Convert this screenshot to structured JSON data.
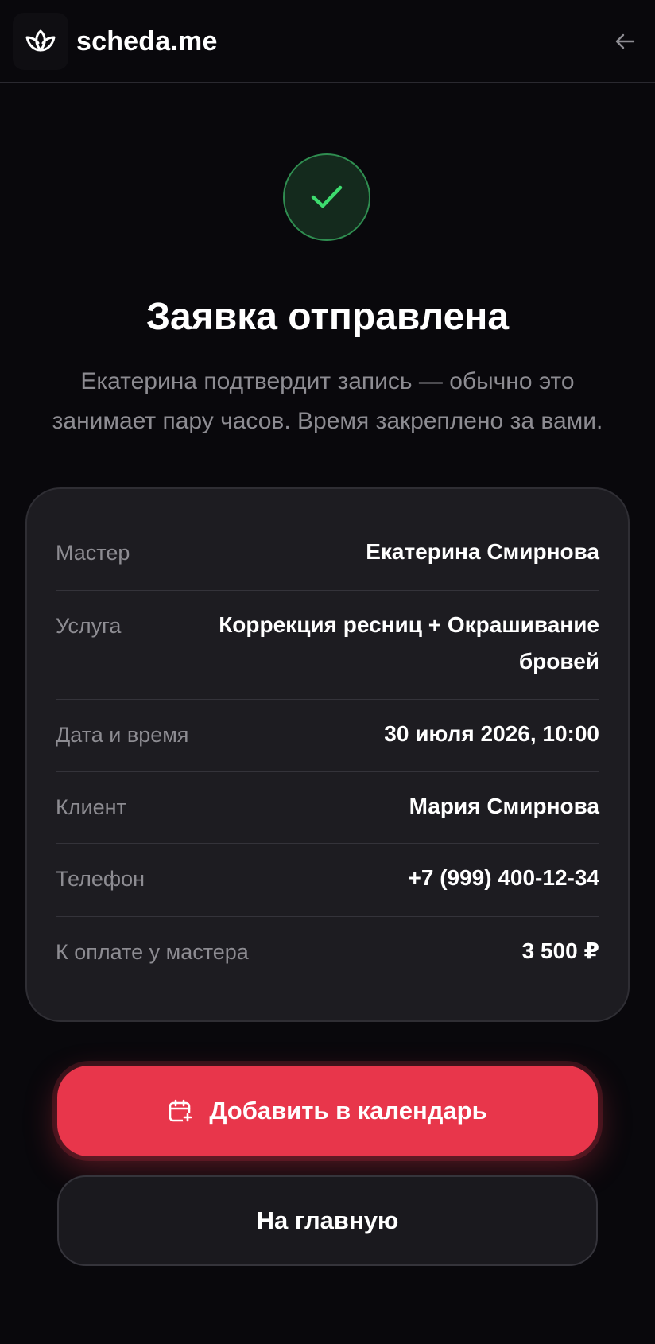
{
  "header": {
    "brand_name": "scheda.me",
    "brand_icon": "lotus-icon",
    "back_icon": "arrow-left-icon"
  },
  "status": {
    "icon": "check-icon",
    "title": "Заявка отправлена",
    "subtitle": "Екатерина подтвердит запись — обычно это занимает пару часов. Время закреплено за вами."
  },
  "details": [
    {
      "label": "Мастер",
      "value": "Екатерина Смирнова"
    },
    {
      "label": "Услуга",
      "value": "Коррекция ресниц + Окрашивание бровей"
    },
    {
      "label": "Дата и время",
      "value": "30 июля 2026, 10:00"
    },
    {
      "label": "Клиент",
      "value": "Мария Смирнова"
    },
    {
      "label": "Телефон",
      "value": "+7 (999) 400-12-34"
    },
    {
      "label": "К оплате у мастера",
      "value": "3 500 ₽"
    }
  ],
  "actions": {
    "add_to_calendar": "Добавить в календарь",
    "calendar_icon": "calendar-plus-icon",
    "go_home": "На главную"
  },
  "colors": {
    "background": "#09080c",
    "accent": "#e8364b",
    "success": "#3ddc6e",
    "card": "#1d1c21"
  }
}
